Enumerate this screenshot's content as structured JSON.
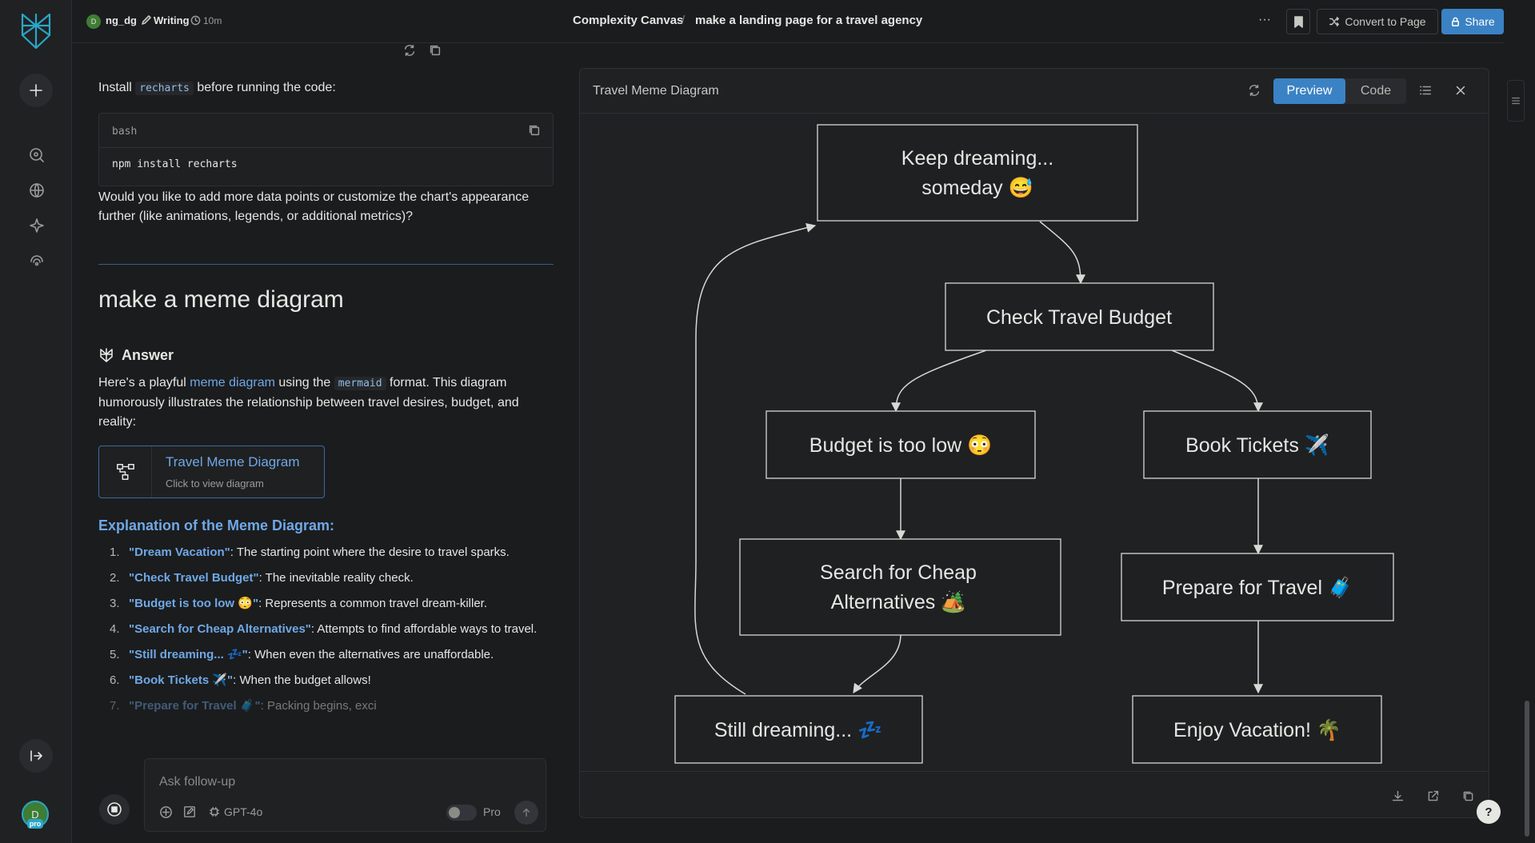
{
  "header": {
    "user_initial": "D",
    "username": "ng_dg",
    "mode": "Writing",
    "elapsed": "10m",
    "space": "Complexity Canvas",
    "separator": "/",
    "thread_title": "make a landing page for a travel agency",
    "more": "···",
    "convert_label": "Convert to Page",
    "share_label": "Share"
  },
  "sidebar": {
    "avatar_initial": "D",
    "pro_badge": "pro",
    "icons": [
      "logo-icon",
      "plus-icon",
      "search-icon",
      "globe-icon",
      "sparkle-icon",
      "broadcast-icon",
      "collapse-icon"
    ]
  },
  "thread": {
    "install_prefix": "Install",
    "install_pkg": "recharts",
    "install_suffix": "before running the code:",
    "code_lang": "bash",
    "code_text": "npm install recharts",
    "followup_text": "Would you like to add more data points or customize the chart's appearance further (like animations, legends, or additional metrics)?",
    "query": "make a meme diagram",
    "answer_label": "Answer",
    "intro_a": "Here's a playful",
    "intro_link": "meme diagram",
    "intro_b": "using the",
    "intro_code": "mermaid",
    "intro_c": "format. This diagram humorously illustrates the relationship between travel desires, budget, and reality:",
    "card_title": "Travel Meme Diagram",
    "card_sub": "Click to view diagram",
    "explain_heading": "Explanation of the Meme Diagram:",
    "explain_items": [
      {
        "num": "1.",
        "term": "\"Dream Vacation\"",
        "desc": ": The starting point where the desire to travel sparks."
      },
      {
        "num": "2.",
        "term": "\"Check Travel Budget\"",
        "desc": ": The inevitable reality check."
      },
      {
        "num": "3.",
        "term": "\"Budget is too low 😳\"",
        "desc": ": Represents a common travel dream-killer."
      },
      {
        "num": "4.",
        "term": "\"Search for Cheap Alternatives\"",
        "desc": ": Attempts to find affordable ways to travel."
      },
      {
        "num": "5.",
        "term": "\"Still dreaming... 💤\"",
        "desc": ": When even the alternatives are unaffordable."
      },
      {
        "num": "6.",
        "term": "\"Book Tickets ✈️\"",
        "desc": ": When the budget allows!"
      },
      {
        "num": "7.",
        "term": "\"Prepare for Travel 🧳\"",
        "desc": ": Packing begins, exci"
      }
    ]
  },
  "composer": {
    "placeholder": "Ask follow-up",
    "model": "GPT-4o",
    "pro_label": "Pro"
  },
  "canvas": {
    "title": "Travel Meme Diagram",
    "tab_preview": "Preview",
    "tab_code": "Code",
    "nodes": {
      "keep_dreaming": [
        "Keep dreaming...",
        "someday 😅"
      ],
      "check_budget": [
        "Check Travel Budget"
      ],
      "budget_low": [
        "Budget is too low 😳"
      ],
      "book_tickets": [
        "Book Tickets ✈️"
      ],
      "search_cheap": [
        "Search for Cheap",
        "Alternatives 🏕️"
      ],
      "prepare": [
        "Prepare for Travel 🧳"
      ],
      "still_dreaming": [
        "Still dreaming... 💤"
      ],
      "enjoy": [
        "Enjoy Vacation! 🌴"
      ]
    }
  },
  "colors": {
    "accent": "#3b82c4",
    "link": "#6fa8e6",
    "background": "#1b1c1e",
    "panel": "#202123",
    "brand": "#2aa6c8"
  },
  "help_label": "?"
}
